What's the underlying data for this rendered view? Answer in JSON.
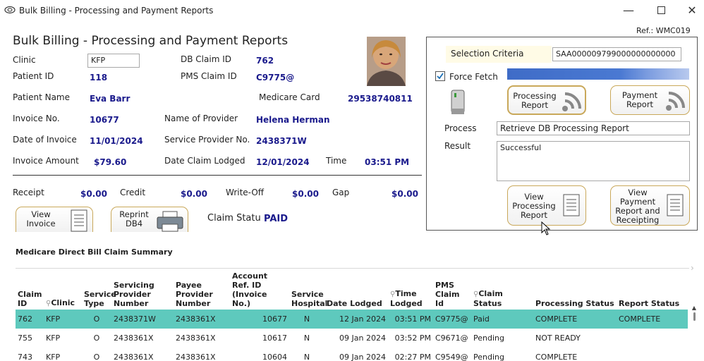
{
  "window": {
    "title": "Bulk Billing - Processing and Payment Reports",
    "ref": "Ref.: WMC019"
  },
  "header": {
    "title": "Bulk Billing - Processing and Payment Reports"
  },
  "claim": {
    "clinic_label": "Clinic",
    "clinic_value": "KFP",
    "db_claim_label": "DB Claim ID",
    "db_claim_value": "762",
    "patient_id_label": "Patient ID",
    "patient_id_value": "118",
    "pms_claim_label": "PMS Claim ID",
    "pms_claim_value": "C9775@",
    "patient_name_label": "Patient Name",
    "patient_name_value": "Eva Barr",
    "medicare_label": "Medicare Card",
    "medicare_value": "29538740811",
    "invoice_no_label": "Invoice No.",
    "invoice_no_value": "10677",
    "provider_name_label": "Name of Provider",
    "provider_name_value": "Helena Herman",
    "invoice_date_label": "Date of Invoice",
    "invoice_date_value": "11/01/2024",
    "service_provider_label": "Service Provider No.",
    "service_provider_value": "2438371W",
    "invoice_amount_label": "Invoice Amount",
    "invoice_amount_value": "$79.60",
    "date_lodged_label": "Date Claim Lodged",
    "date_lodged_value": "12/01/2024",
    "time_label": "Time",
    "time_value": "03:51 PM"
  },
  "totals": {
    "receipt_label": "Receipt",
    "receipt_value": "$0.00",
    "credit_label": "Credit",
    "credit_value": "$0.00",
    "writeoff_label": "Write-Off",
    "writeoff_value": "$0.00",
    "gap_label": "Gap",
    "gap_value": "$0.00"
  },
  "buttons": {
    "view_invoice_l1": "View",
    "view_invoice_l2": "Invoice",
    "reprint_l1": "Reprint",
    "reprint_l2": "DB4",
    "processing_report_l1": "Processing",
    "processing_report_l2": "Report",
    "payment_report_l1": "Payment",
    "payment_report_l2": "Report",
    "view_proc_l1": "View",
    "view_proc_l2": "Processing",
    "view_proc_l3": "Report",
    "view_pay_l1": "View",
    "view_pay_l2": "Payment",
    "view_pay_l3": "Report and",
    "view_pay_l4": "Receipting"
  },
  "claim_status": {
    "label": "Claim Statu",
    "value": "PAID"
  },
  "criteria": {
    "label": "Selection Criteria",
    "value": "SAA000009799000000000000",
    "force_fetch_label": "Force Fetch",
    "force_fetch_checked": true,
    "process_label": "Process",
    "process_value": "Retrieve DB Processing Report",
    "result_label": "Result",
    "result_value": "Successful"
  },
  "summary": {
    "title": "Medicare Direct Bill Claim Summary",
    "columns": [
      "Claim ID",
      "Clinic",
      "Service Type",
      "Servicing Provider Number",
      "Payee Provider Number",
      "Account Ref. ID (Invoice No.)",
      "Service Hospital",
      "Date Lodged",
      "Time Lodged",
      "PMS Claim Id",
      "Claim Status",
      "Processing Status",
      "Report Status"
    ],
    "rows": [
      [
        "762",
        "KFP",
        "O",
        "2438371W",
        "2438361X",
        "10677",
        "N",
        "12 Jan 2024",
        "03:51 PM",
        "C9775@",
        "Paid",
        "COMPLETE",
        "COMPLETE"
      ],
      [
        "755",
        "KFP",
        "O",
        "2438361X",
        "2438361X",
        "10617",
        "N",
        "09 Jan 2024",
        "03:52 PM",
        "C9671@",
        "Pending",
        "NOT READY",
        ""
      ],
      [
        "743",
        "KFP",
        "O",
        "2438361X",
        "2438361X",
        "10604",
        "N",
        "09 Jan 2024",
        "02:27 PM",
        "C9549@",
        "Pending",
        "COMPLETE",
        ""
      ]
    ]
  },
  "colors": {
    "value_text": "#1a1a8c",
    "selected_row": "#5ec9bd",
    "button_border": "#c9a85a"
  },
  "icons": [
    "app-icon",
    "minimize-icon",
    "maximize-icon",
    "close-icon",
    "patient-photo",
    "card-reader-icon",
    "wireless-icon",
    "document-icon",
    "printer-icon",
    "checkbox-icon",
    "filter-icon",
    "cursor-icon"
  ]
}
